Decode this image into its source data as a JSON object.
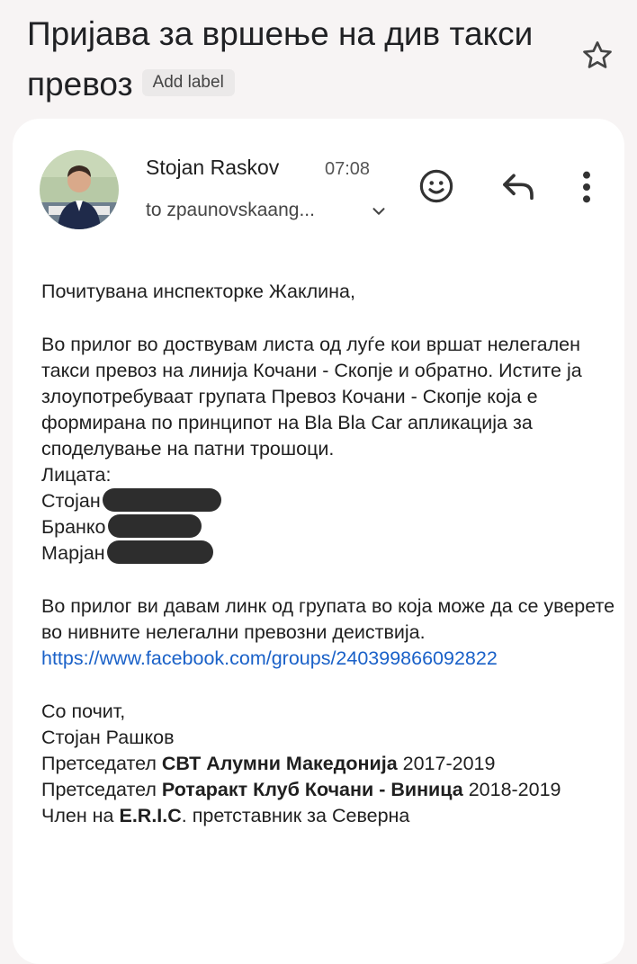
{
  "email": {
    "subject": "Пријава за вршење на див такси превоз",
    "label_chip": "Add label",
    "sender_name": "Stojan Raskov",
    "time": "07:08",
    "recipients": "to zpaunovskaang..."
  },
  "body": {
    "greeting": "Почитувана инспекторке Жаклина,",
    "para1": "Во прилог во доствувам листа од луѓе кои вршат нелегален такси превоз на линија Кочани - Скопје и обратно. Иститe ја злоупотребуваат групата Превоз Кочани - Скопје која е формирана по принципот на Bla Bla Car апликација за споделување на патни трошоци.",
    "persons_label": "Лицата:",
    "persons": [
      "Стојан",
      "Бранко",
      "Марјан"
    ],
    "para2": "Во прилог ви давам линк од групата во која може да се уверете во нивните нелегални превозни деиствија.",
    "link": "https://www.facebook.com/groups/240399866092822",
    "closing": "Со почит,",
    "signature_name": "Стојан Рашков",
    "sig_line1_pre": "Претседател ",
    "sig_line1_bold": "СВТ Алумни Македонија",
    "sig_line1_post": " 2017-2019",
    "sig_line2_pre": "Претседател ",
    "sig_line2_bold": "Ротаракт Клуб Кочани - Виница",
    "sig_line2_post": "  2018-2019",
    "sig_line3_pre": "Член на ",
    "sig_line3_bold": "E.R.I.C",
    "sig_line3_post": ". претставник за Северна"
  },
  "icons": {
    "star": "star-outline-icon",
    "emoji": "add-reaction-icon",
    "reply": "reply-icon",
    "more": "more-vertical-icon",
    "chevron": "chevron-down-icon"
  },
  "colors": {
    "link": "#1a61c8",
    "background": "#f7f4f4",
    "card": "#ffffff"
  }
}
